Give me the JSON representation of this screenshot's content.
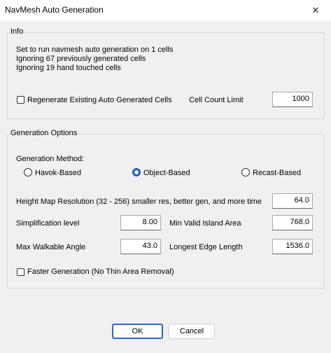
{
  "window": {
    "title": "NavMesh Auto Generation",
    "close_glyph": "✕"
  },
  "info": {
    "label": "Info",
    "lines": [
      "Set to run navmesh auto generation on 1 cells",
      "Ignoring 67 previously generated cells",
      "Ignoring 19 hand touched cells"
    ],
    "regenerate_label": "Regenerate Existing Auto Generated Cells",
    "regenerate_checked": false,
    "cell_count_label": "Cell Count Limit",
    "cell_count_value": "1000"
  },
  "options": {
    "label": "Generation Options",
    "method_label": "Generation Method:",
    "methods": [
      {
        "label": "Havok-Based",
        "selected": false
      },
      {
        "label": "Object-Based",
        "selected": true
      },
      {
        "label": "Recast-Based",
        "selected": false
      }
    ],
    "height_map_label": "Height Map Resolution (32 - 256) smaller res, better gen, and more time",
    "height_map_value": "64.0",
    "simplification_label": "Simplification level",
    "simplification_value": "8.00",
    "min_island_label": "Min Valid Island Area",
    "min_island_value": "768.0",
    "max_walkable_label": "Max Walkable Angle",
    "max_walkable_value": "43.0",
    "longest_edge_label": "Longest Edge Length",
    "longest_edge_value": "1536.0",
    "faster_label": "Faster Generation (No Thin Area Removal)",
    "faster_checked": false
  },
  "buttons": {
    "ok": "OK",
    "cancel": "Cancel"
  }
}
